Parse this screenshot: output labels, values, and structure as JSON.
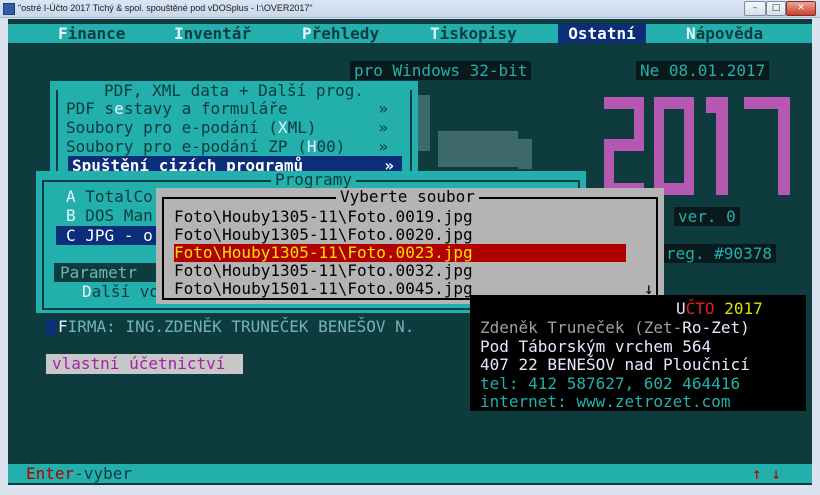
{
  "window": {
    "title": "\"ostré I-Účto 2017 Tichý & spol. spouštěné pod vDOSplus - I:\\OVER2017\"",
    "min_icon": "minimize-icon",
    "max_icon": "maximize-icon",
    "close_icon": "close-icon"
  },
  "menubar": {
    "items": [
      {
        "hot": "F",
        "rest": "inance"
      },
      {
        "hot": "I",
        "rest": "nventář"
      },
      {
        "hot": "P",
        "rest": "řehledy"
      },
      {
        "hot": "T",
        "rest": "iskopisy"
      },
      {
        "hot": "",
        "rest": "Ostatní"
      },
      {
        "hot": "N",
        "rest": "ápověda"
      }
    ],
    "active": "Ostatní"
  },
  "header": {
    "windows_label": "pro Windows 32-bit",
    "date_label": "Ne 08.01.2017",
    "version_label": "ver. 0",
    "reg_label": "reg. #90378",
    "logo_year": "2017"
  },
  "pdf_menu": {
    "title": "PDF, XML data + Další prog.",
    "items": [
      {
        "pre": "PDF s",
        "hot": "e",
        "post": "stavy a formuláře",
        "arrow": "»"
      },
      {
        "pre": "Soubory pro e-podání (",
        "hot": "X",
        "post": "ML)",
        "arrow": "»"
      },
      {
        "pre": "Soubory pro e-podání ZP (",
        "hot": "H",
        "post": "00)",
        "arrow": "»"
      },
      {
        "pre": "Spuštění cizích programů",
        "hot": "",
        "post": "",
        "arrow": "»"
      }
    ]
  },
  "programs": {
    "title": "Programy",
    "items": [
      {
        "hot": "A",
        "rest": " TotalCo"
      },
      {
        "hot": "B",
        "rest": " DOS Man"
      },
      {
        "hot": "C",
        "rest": " JPG - o"
      }
    ],
    "param_label": "Parametr",
    "dalsi": {
      "hot": "D",
      "rest": "alší vo"
    }
  },
  "file_picker": {
    "title": "Vyberte soubor",
    "files": [
      "Foto\\Houby1305-11\\Foto.0019.jpg",
      "Foto\\Houby1305-11\\Foto.0020.jpg",
      "Foto\\Houby1305-11\\Foto.0023.jpg",
      "Foto\\Houby1305-11\\Foto.0032.jpg",
      "Foto\\Houby1501-11\\Foto.0045.jpg"
    ],
    "selected_index": 2,
    "scroll_glyph": "↓"
  },
  "firma": {
    "hot": "F",
    "rest": "IRMA: ING.ZDENĚK TRUNEČEK BENEŠOV N."
  },
  "accounting_type": "vlastní účetnictví",
  "info": {
    "product_u": "U",
    "product_rest": "ČTO",
    "product_year": "2017",
    "author_pre": "Zdeněk Truneček (Zet-",
    "author_rz": "Ro-Zet)",
    "street": "Pod Táborským vrchem 564",
    "city": "407 22 BENEŠOV nad Ploučnicí",
    "tel": "tel: 412 587627, 602 464416",
    "web": "internet: www.zetrozet.com"
  },
  "statusbar": {
    "enter_key": "Enter",
    "enter_action": "-vyber",
    "arrows": "↑ ↓"
  },
  "colors": {
    "background": "#0d3b3e",
    "cyan": "#23b0ad",
    "highlight_blue": "#0b2d7a",
    "selection_red": "#b00000",
    "selection_text": "#ffe000",
    "logo_magenta": "#b458b4"
  }
}
